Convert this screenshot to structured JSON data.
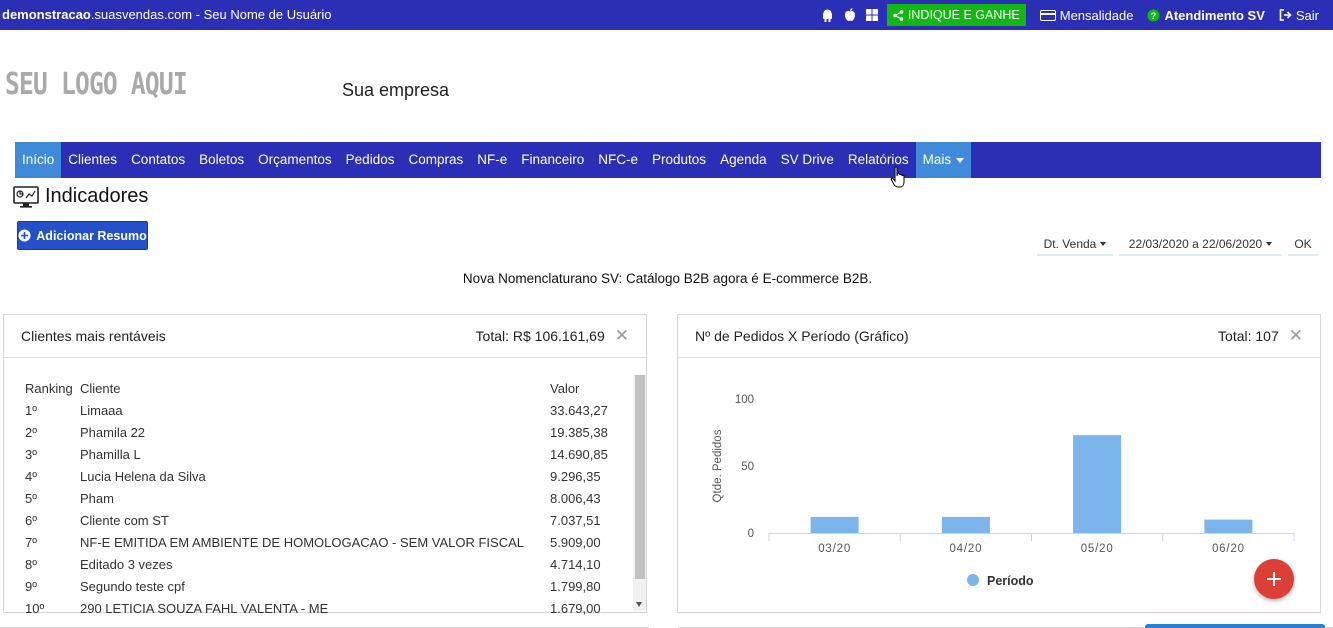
{
  "topbar": {
    "domain_bold": "demonstracao",
    "domain_rest": ".suasvendas.com",
    "separator": " - ",
    "user": "Seu Nome de Usuário",
    "indique": "INDIQUE E GANHE",
    "mensalidade": "Mensalidade",
    "atendimento": "Atendimento SV",
    "sair": "Sair"
  },
  "logo": "SEU LOGO AQUI",
  "company": "Sua empresa",
  "nav": [
    "Início",
    "Clientes",
    "Contatos",
    "Boletos",
    "Orçamentos",
    "Pedidos",
    "Compras",
    "NF-e",
    "Financeiro",
    "NFC-e",
    "Produtos",
    "Agenda",
    "SV Drive",
    "Relatórios"
  ],
  "nav_more": "Mais",
  "indicadores": {
    "title": "Indicadores",
    "add_button": "Adicionar Resumo",
    "filter_field": "Dt. Venda",
    "filter_range": "22/03/2020 a 22/06/2020",
    "ok": "OK"
  },
  "notice": "Nova Nomenclaturano SV: Catálogo B2B agora é E-commerce B2B.",
  "panel_left": {
    "title": "Clientes mais rentáveis",
    "total": "Total: R$ 106.161,69",
    "columns": [
      "Ranking",
      "Cliente",
      "Valor"
    ],
    "rows": [
      {
        "rank": "1º",
        "cliente": "Limaaa",
        "valor": "33.643,27"
      },
      {
        "rank": "2º",
        "cliente": "Phamila 22",
        "valor": "19.385,38"
      },
      {
        "rank": "3º",
        "cliente": "Phamilla L",
        "valor": "14.690,85"
      },
      {
        "rank": "4º",
        "cliente": "Lucia Helena da Silva",
        "valor": "9.296,35"
      },
      {
        "rank": "5º",
        "cliente": "Pham",
        "valor": "8.006,43"
      },
      {
        "rank": "6º",
        "cliente": "Cliente com ST",
        "valor": "7.037,51"
      },
      {
        "rank": "7º",
        "cliente": "NF-E EMITIDA EM AMBIENTE DE HOMOLOGACAO - SEM VALOR FISCAL",
        "valor": "5.909,00"
      },
      {
        "rank": "8º",
        "cliente": "Editado 3 vezes",
        "valor": "4.714,10"
      },
      {
        "rank": "9º",
        "cliente": "Segundo teste cpf",
        "valor": "1.799,80"
      },
      {
        "rank": "10º",
        "cliente": "290 LETICIA SOUZA FAHL VALENTA - ME",
        "valor": "1.679,00"
      }
    ]
  },
  "panel_right": {
    "title": "Nº de Pedidos X Período (Gráfico)",
    "total": "Total: 107"
  },
  "colors": {
    "topbar": "#2a2fb5",
    "nav_active": "#3f8bd9",
    "indique": "#12b812",
    "bar": "#7cb5ec",
    "fab": "#db3f35"
  },
  "chart_data": {
    "type": "bar",
    "categories": [
      "03/20",
      "04/20",
      "05/20",
      "06/20"
    ],
    "series": [
      {
        "name": "Período",
        "values": [
          12,
          12,
          73,
          10
        ]
      }
    ],
    "ylabel": "Qtde. Pedidos",
    "xlabel": "",
    "yticks": [
      0,
      50,
      100
    ],
    "ylim": [
      0,
      100
    ],
    "grid": false,
    "legend": "bottom-center"
  }
}
